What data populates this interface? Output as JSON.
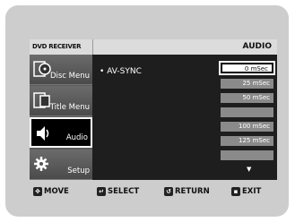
{
  "header": {
    "brand": "DVD RECEIVER",
    "section": "AUDIO"
  },
  "sidebar": {
    "items": [
      {
        "label": "Disc Menu",
        "icon": "disc-menu-icon"
      },
      {
        "label": "Title Menu",
        "icon": "title-menu-icon"
      },
      {
        "label": "Audio",
        "icon": "speaker-icon",
        "active": true
      },
      {
        "label": "Setup",
        "icon": "gear-icon"
      }
    ]
  },
  "submenu": {
    "label": "AV-SYNC",
    "bullet": "•"
  },
  "options": [
    {
      "label": "0 mSec",
      "selected": true
    },
    {
      "label": "25 mSec"
    },
    {
      "label": "50 mSec"
    },
    {
      "label": ""
    },
    {
      "label": "100 mSec"
    },
    {
      "label": "125 mSec"
    },
    {
      "label": ""
    }
  ],
  "footer": {
    "move": "MOVE",
    "select": "SELECT",
    "return": "RETURN",
    "exit": "EXIT"
  },
  "colors": {
    "panel_bg": "#1e1e1e",
    "option_bg": "#8a8a8a",
    "header_bg": "#dcdcdc"
  }
}
